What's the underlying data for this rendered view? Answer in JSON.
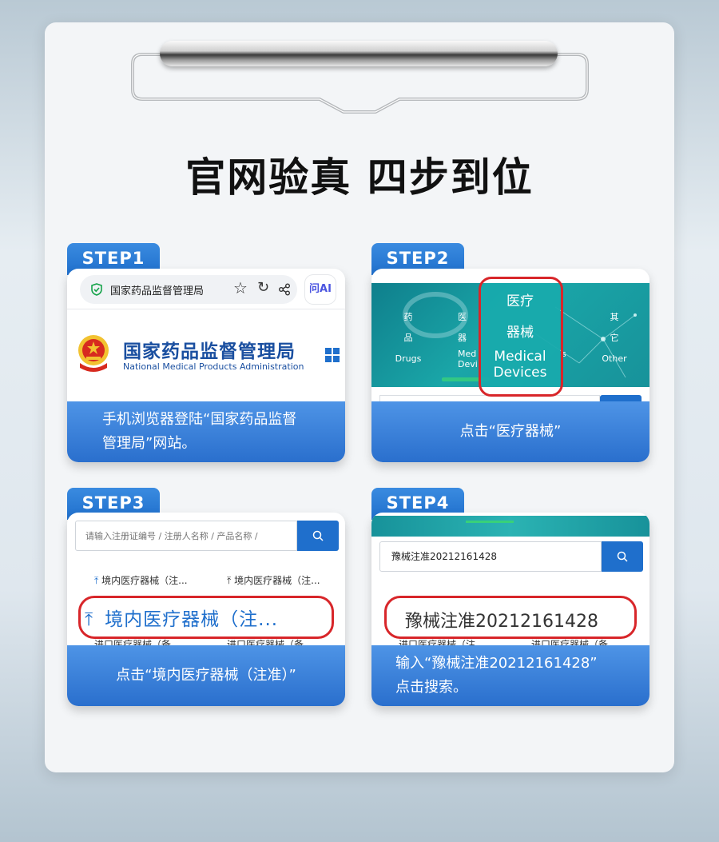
{
  "title": "官网验真 四步到位",
  "colors": {
    "accent": "#1f6fcc",
    "highlight": "#d8262a",
    "teal": "#1aa6a8"
  },
  "step1": {
    "tab": "STEP1",
    "browser_title": "国家药品监督管理局",
    "ai_label": "问AI",
    "site_name_cn": "国家药品监督管理局",
    "site_name_en": "National Medical Products Administration",
    "caption": "手机浏览器登陆“国家药品监督管理局”网站。"
  },
  "step2": {
    "tab": "STEP2",
    "cats": [
      {
        "cn1": "药",
        "cn2": "品",
        "en": "Drugs"
      },
      {
        "cn1": "医",
        "cn2": "器",
        "en1": "Med",
        "en2": "Devi"
      },
      {
        "cn1": "其",
        "cn2": "它",
        "en": "Other"
      }
    ],
    "highlight_cn1": "医疗",
    "highlight_cn2": "器械",
    "highlight_en1": "Medical",
    "highlight_en2": "Devices",
    "edge_char": "s",
    "caption": "点击“医疗器械”"
  },
  "step3": {
    "tab": "STEP3",
    "search_placeholder": "请输入注册证编号 / 注册人名称 / 产品名称 /",
    "row1_left": "境内医疗器械（注...",
    "row1_right": "境内医疗器械（注...",
    "highlight_text": "境内医疗器械（注...",
    "row3_left": "进口医疗器械（备",
    "row3_right": "进口医疗器械（备",
    "caption": "点击“境内医疗器械（注准）”"
  },
  "step4": {
    "tab": "STEP4",
    "search_value": "豫械注准20212161428",
    "highlight_text": "豫械注准20212161428",
    "row3_left": "进口医疗器械（注",
    "row3_right": "进口医疗器械（备",
    "caption_line1": "输入“豫械注准20212161428”",
    "caption_line2": "点击搜索。"
  }
}
